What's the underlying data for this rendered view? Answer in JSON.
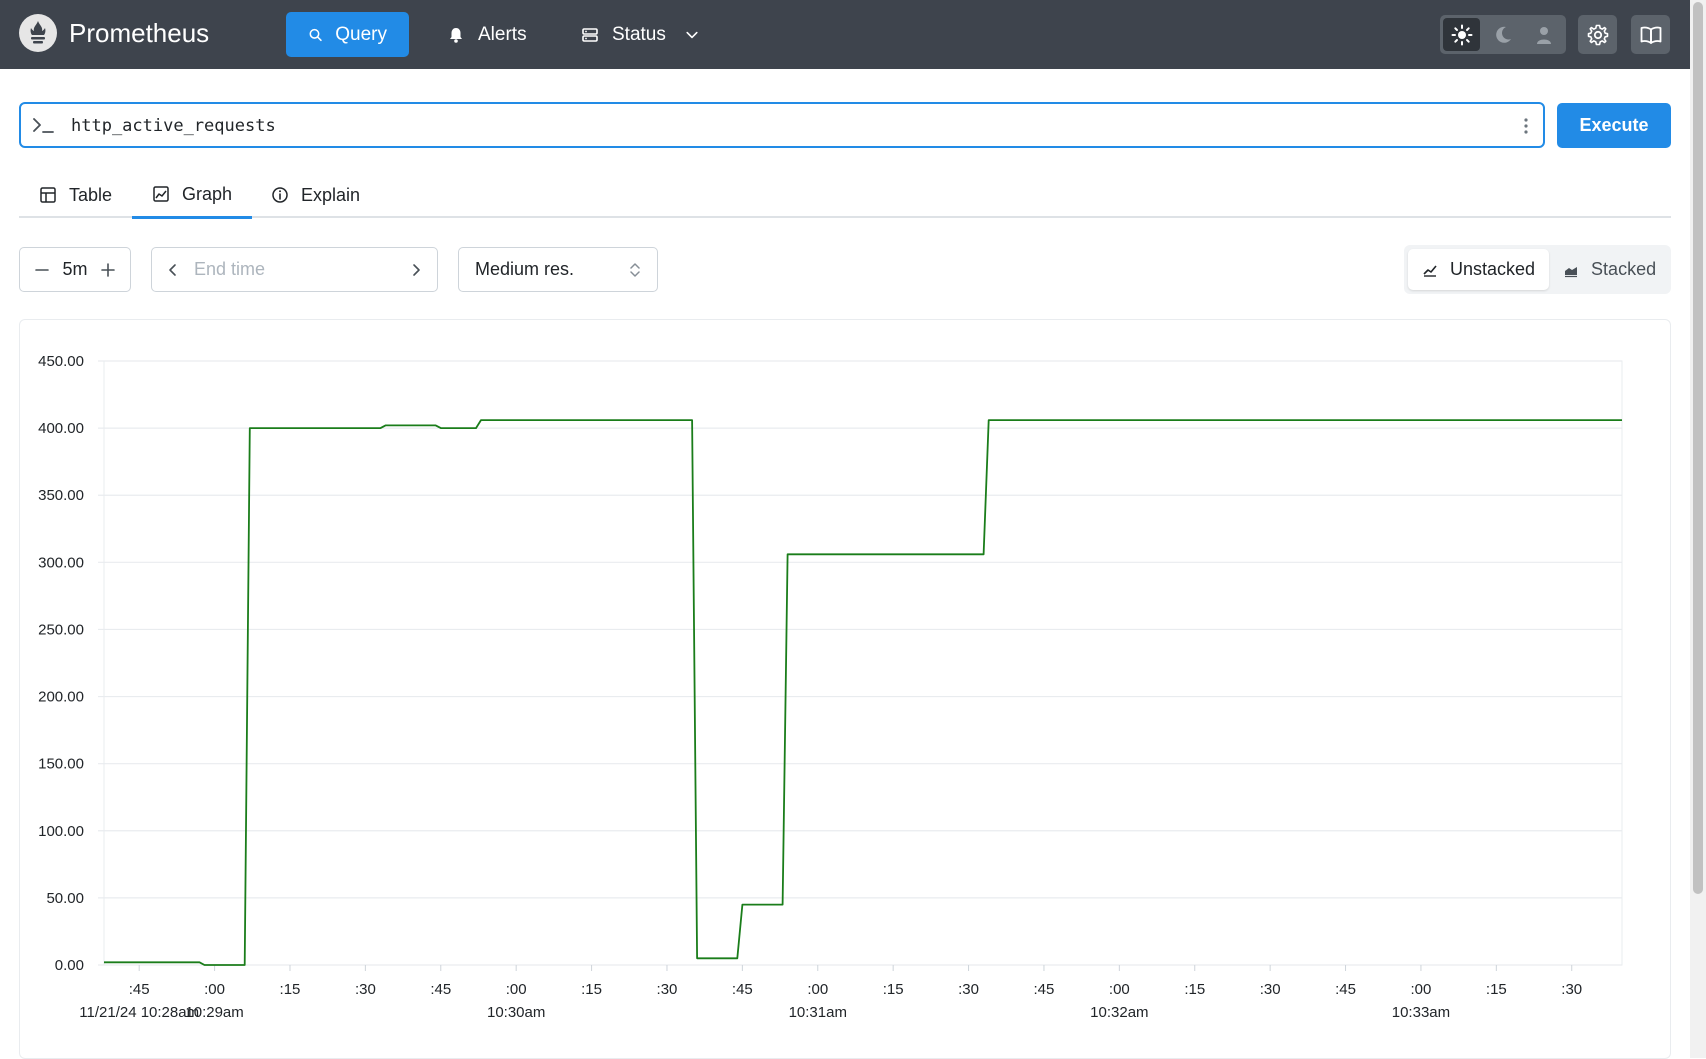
{
  "header": {
    "title": "Prometheus",
    "nav": {
      "query": "Query",
      "alerts": "Alerts",
      "status": "Status"
    }
  },
  "query": {
    "expression": "http_active_requests",
    "execute_label": "Execute"
  },
  "tabs": {
    "table": "Table",
    "graph": "Graph",
    "explain": "Explain"
  },
  "controls": {
    "range": "5m",
    "end_time_placeholder": "End time",
    "resolution": "Medium res.",
    "unstacked": "Unstacked",
    "stacked": "Stacked"
  },
  "colors": {
    "accent": "#228be6",
    "navbar": "#3e444d",
    "series": "#1a7d1a"
  },
  "chart_data": {
    "type": "line",
    "ylim": [
      0,
      450
    ],
    "y_ticks": [
      0,
      50,
      100,
      150,
      200,
      250,
      300,
      350,
      400,
      450
    ],
    "y_tick_labels": [
      "0.00",
      "50.00",
      "100.00",
      "150.00",
      "200.00",
      "250.00",
      "300.00",
      "350.00",
      "400.00",
      "450.00"
    ],
    "x_range": [
      "10:28:38",
      "10:33:40"
    ],
    "x_ticks": [
      {
        "t": "10:28:45",
        "label": ":45",
        "sub": "11/21/24 10:28am"
      },
      {
        "t": "10:29:00",
        "label": ":00",
        "sub": "10:29am"
      },
      {
        "t": "10:29:15",
        "label": ":15",
        "sub": ""
      },
      {
        "t": "10:29:30",
        "label": ":30",
        "sub": ""
      },
      {
        "t": "10:29:45",
        "label": ":45",
        "sub": ""
      },
      {
        "t": "10:30:00",
        "label": ":00",
        "sub": "10:30am"
      },
      {
        "t": "10:30:15",
        "label": ":15",
        "sub": ""
      },
      {
        "t": "10:30:30",
        "label": ":30",
        "sub": ""
      },
      {
        "t": "10:30:45",
        "label": ":45",
        "sub": ""
      },
      {
        "t": "10:31:00",
        "label": ":00",
        "sub": "10:31am"
      },
      {
        "t": "10:31:15",
        "label": ":15",
        "sub": ""
      },
      {
        "t": "10:31:30",
        "label": ":30",
        "sub": ""
      },
      {
        "t": "10:31:45",
        "label": ":45",
        "sub": ""
      },
      {
        "t": "10:32:00",
        "label": ":00",
        "sub": "10:32am"
      },
      {
        "t": "10:32:15",
        "label": ":15",
        "sub": ""
      },
      {
        "t": "10:32:30",
        "label": ":30",
        "sub": ""
      },
      {
        "t": "10:32:45",
        "label": ":45",
        "sub": ""
      },
      {
        "t": "10:33:00",
        "label": ":00",
        "sub": "10:33am"
      },
      {
        "t": "10:33:15",
        "label": ":15",
        "sub": ""
      },
      {
        "t": "10:33:30",
        "label": ":30",
        "sub": ""
      }
    ],
    "series": [
      {
        "points": [
          [
            "10:28:38",
            2
          ],
          [
            "10:28:57",
            2
          ],
          [
            "10:28:58",
            0
          ],
          [
            "10:29:06",
            0
          ],
          [
            "10:29:07",
            400
          ],
          [
            "10:29:33",
            400
          ],
          [
            "10:29:34",
            402
          ],
          [
            "10:29:44",
            402
          ],
          [
            "10:29:45",
            400
          ],
          [
            "10:29:52",
            400
          ],
          [
            "10:29:53",
            406
          ],
          [
            "10:30:35",
            406
          ],
          [
            "10:30:36",
            5
          ],
          [
            "10:30:44",
            5
          ],
          [
            "10:30:45",
            45
          ],
          [
            "10:30:53",
            45
          ],
          [
            "10:30:54",
            306
          ],
          [
            "10:31:33",
            306
          ],
          [
            "10:31:34",
            406
          ],
          [
            "10:33:40",
            406
          ]
        ]
      }
    ]
  }
}
